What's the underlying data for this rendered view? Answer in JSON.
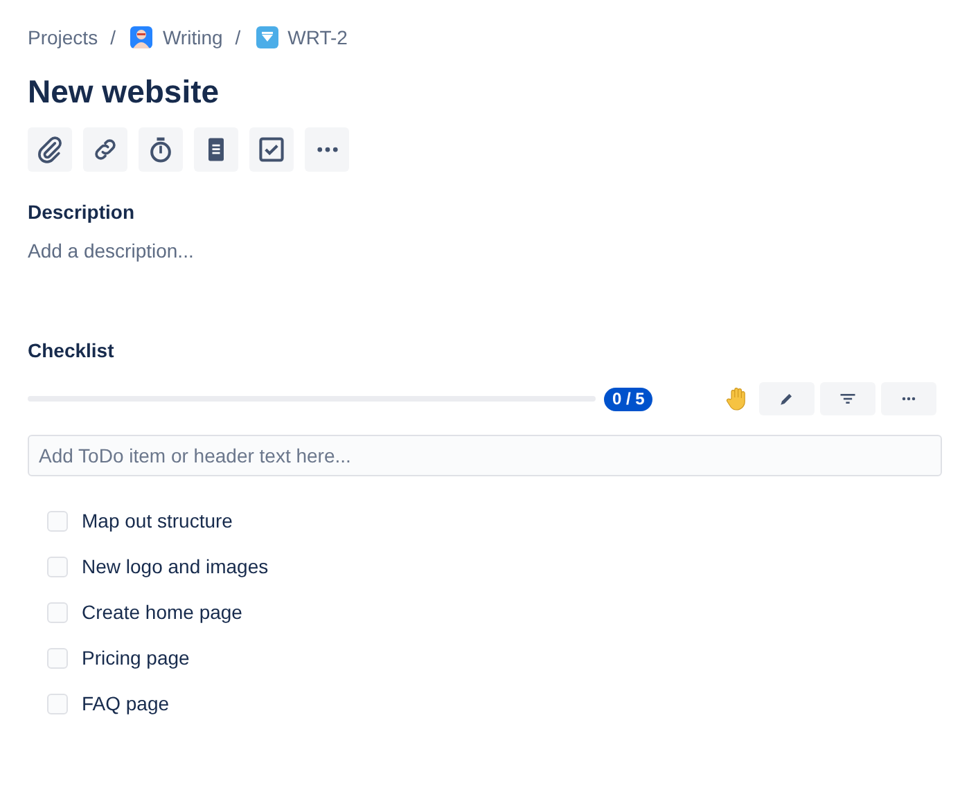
{
  "breadcrumbs": [
    {
      "label": "Projects",
      "kind": "text"
    },
    {
      "separator": "/",
      "label": "Writing",
      "kind": "project"
    },
    {
      "separator": "/",
      "label": "WRT-2",
      "kind": "issue"
    }
  ],
  "title": "New website",
  "description": {
    "heading": "Description",
    "placeholder": "Add a description..."
  },
  "checklist": {
    "heading": "Checklist",
    "progress": {
      "level": 0,
      "badge": "0 / 5"
    },
    "input": {
      "placeholder": "Add ToDo item or header text here..."
    },
    "items": [
      {
        "label": "Map out structure",
        "checked": false
      },
      {
        "label": "New logo and images",
        "checked": false
      },
      {
        "label": "Create home page",
        "checked": false
      },
      {
        "label": "Pricing page",
        "checked": false
      },
      {
        "label": "FAQ page",
        "checked": false
      }
    ]
  }
}
